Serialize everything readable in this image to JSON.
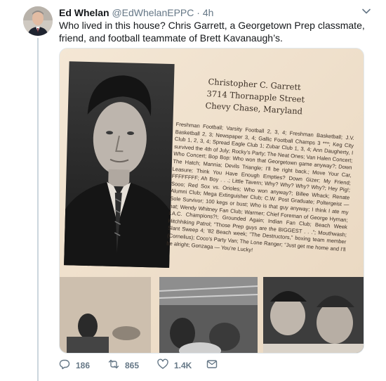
{
  "author": {
    "name": "Ed Whelan",
    "handle": "@EdWhelanEPPC",
    "separator": "·",
    "time": "4h"
  },
  "tweet": {
    "text": "Who lived in this house? Chris Garrett, a Georgetown Prep classmate, friend, and football teammate of Brett Kavanaugh’s."
  },
  "yearbook": {
    "name": "Christopher C. Garrett",
    "street": "3714 Thornapple Street",
    "city": "Chevy Chase, Maryland",
    "bio": "Freshman Football; Varsity Football 2, 3, 4; Freshman Basketball; J.V. Basketball 2, 3; Newspaper 3, 4; Gallic Football Champs 3 ***; Keg City Club 1, 2, 3, 4; Spread Eagle Club 1; Zubar Club 1, 3, 4; Ann Daugherty, I survived the 4th of July; Rocky’s Party; The Neat Ones; Van Halen Concert; Who Concert; Bop Bop: Who won that Georgetown game anyway?; Down The Hatch; Mannia; Devils Triangle; I’ll be right back.; Move Your Car, Leasure; Think You Have Enough Empties? Down Gizer; My Friend; FFFFFFFF; Ah Boy . . .; Little Tavern; Why? Why? Why? Why?; Hey Pig!; Sooo; Red Sox vs. Orioles; Who won anyway?; Billee Whack; Renate Alumni Club; Mega Extinguisher Club; C.W. Post Graduate; Poltergeist — Sole Survivor; 100 kegs or bust; Who is that guy anyway; I think I ate my hat; Wendy Whitney Fan Club; Warmer; Chief Foreman of George Hyman; I.A.C. Champions?!; Grounded Again; Indian Fan Club; Beach Week Hitchhiking Patrol; “Those Prep guys are the BIGGEST . . .”; Mouthwash; Slant Sweep 4; ’82 Beach week; “The Destructors,” boxing team member (Cornelius); Coco’s Party Van; The Lone Ranger; “Just get me home and I’ll be alright; Gonzaga — You’re Lucky!"
  },
  "actions": {
    "reply_count": "186",
    "retweet_count": "865",
    "like_count": "1.4K"
  },
  "icons": {
    "caret": "chevron-down-icon",
    "reply": "reply-icon",
    "retweet": "retweet-icon",
    "like": "heart-icon",
    "dm": "envelope-icon"
  },
  "colors": {
    "text": "#14171a",
    "secondary": "#657786",
    "paper": "#efe2d0"
  }
}
